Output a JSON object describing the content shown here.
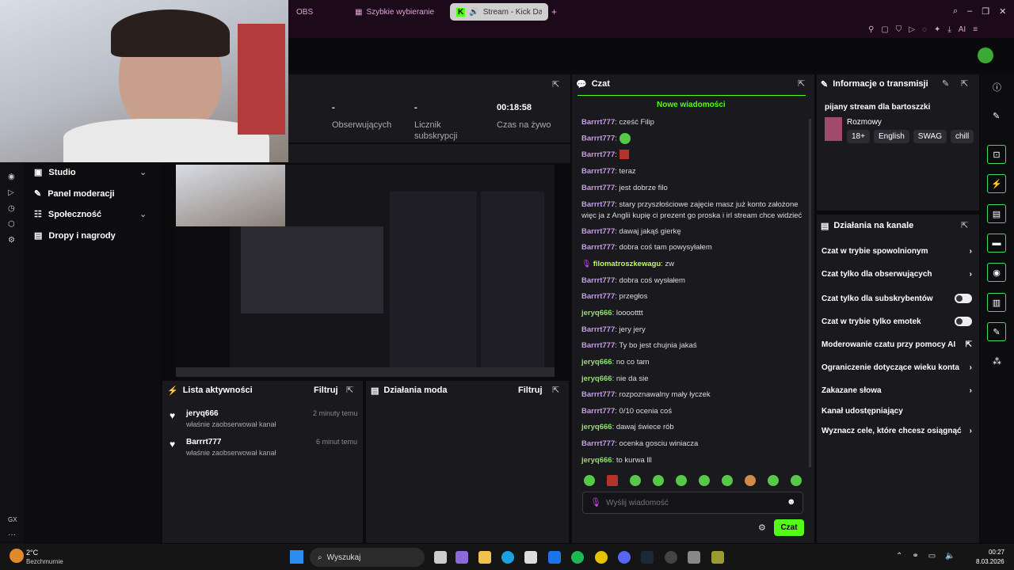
{
  "browser": {
    "tabs": [
      {
        "label": "OBS"
      },
      {
        "label": "Szybkie wybieranie"
      },
      {
        "label": "Stream - Kick Dashbo"
      }
    ],
    "new_tab_icon": "plus-icon",
    "ai_label": "AI"
  },
  "stats": [
    {
      "value": "-",
      "label": "Obserwujących"
    },
    {
      "value": "-",
      "label": "Licznik subskrypcji"
    },
    {
      "value": "00:18:58",
      "label": "Czas na żywo"
    }
  ],
  "sidebar": {
    "items": [
      {
        "label": "Studio",
        "icon": "studio-icon"
      },
      {
        "label": "Panel moderacji",
        "icon": "wrench-icon"
      },
      {
        "label": "Społeczność",
        "icon": "community-icon"
      },
      {
        "label": "Dropy i nagrody",
        "icon": "gift-icon"
      }
    ],
    "bottom_label": "GX"
  },
  "activity": {
    "title": "Lista aktywności",
    "filter": "Filtruj",
    "items": [
      {
        "user": "jeryq666",
        "sub": "właśnie zaobserwował kanał",
        "time": "2 minuty temu"
      },
      {
        "user": "Barrrt777",
        "sub": "właśnie zaobserwował kanał",
        "time": "6 minut temu"
      }
    ]
  },
  "moderation": {
    "title": "Działania moda",
    "filter": "Filtruj"
  },
  "chat": {
    "title": "Czat",
    "new_messages": "Nowe wiadomości",
    "messages": [
      {
        "user": "Barrrt777",
        "text": "cześć Filip"
      },
      {
        "user": "Barrrt777",
        "text": ""
      },
      {
        "user": "Barrrt777",
        "text": ""
      },
      {
        "user": "Barrrt777",
        "text": "teraz"
      },
      {
        "user": "Barrrt777",
        "text": "jest dobrze filo"
      },
      {
        "user": "Barrrt777",
        "text": "stary przyszłościowe zajęcie masz już konto założone więc ja z Anglii kupię ci prezent go proska i irl stream chce widzieć"
      },
      {
        "user": "Barrrt777",
        "text": "dawaj jakąś gierkę"
      },
      {
        "user": "Barrrt777",
        "text": "dobra coś tam powysyłałem"
      },
      {
        "user": "filomatroszkewagu",
        "text": "zw"
      },
      {
        "user": "Barrrt777",
        "text": "dobra coś wysłałem"
      },
      {
        "user": "Barrrt777",
        "text": "przegłos"
      },
      {
        "user": "jeryq666",
        "text": "looootttt"
      },
      {
        "user": "Barrrt777",
        "text": "jery jery"
      },
      {
        "user": "Barrrt777",
        "text": "Ty bo jest chujnia jakaś"
      },
      {
        "user": "jeryq666",
        "text": "no co tam"
      },
      {
        "user": "jeryq666",
        "text": "nie da sie"
      },
      {
        "user": "Barrrt777",
        "text": "rozpoznawalny mały łyczek"
      },
      {
        "user": "Barrrt777",
        "text": "0/10 ocenia coś"
      },
      {
        "user": "jeryq666",
        "text": "dawaj świece rób"
      },
      {
        "user": "Barrrt777",
        "text": "ocenka gosciu winiacza"
      },
      {
        "user": "jeryq666",
        "text": "to kurwa lll"
      }
    ],
    "input_placeholder": "Wyślij wiadomość",
    "send_label": "Czat"
  },
  "info": {
    "title": "Informacje o transmisji",
    "stream_title": "pijany stream dla bartoszzki",
    "category": "Rozmowy",
    "tags": [
      "18+",
      "English",
      "SWAG",
      "chill"
    ]
  },
  "actions": {
    "title": "Działania na kanale",
    "items": [
      {
        "label": "Czat w trybie spowolnionym",
        "control": "chevron"
      },
      {
        "label": "Czat tylko dla obserwujących",
        "control": "chevron"
      },
      {
        "label": "Czat tylko dla subskrybentów",
        "control": "toggle"
      },
      {
        "label": "Czat w trybie tylko emotek",
        "control": "toggle"
      },
      {
        "label": "Moderowanie czatu przy pomocy AI",
        "control": "external"
      },
      {
        "label": "Ograniczenie dotyczące wieku konta",
        "control": "chevron"
      },
      {
        "label": "Zakazane słowa",
        "control": "chevron"
      },
      {
        "label": "Kanał udostępniający",
        "control": "none"
      },
      {
        "label": "Wyznacz cele, które chcesz osiągnąć",
        "control": "chevron"
      }
    ]
  },
  "taskbar": {
    "weather": "2°C",
    "weather_desc": "Bezchmurnie",
    "search": "Wyszukaj",
    "time": "00:27",
    "date": "8.03.2026"
  },
  "colors": {
    "accent": "#53fc18",
    "brand_bg": "#1c0a1a",
    "panel": "#1a1a1e"
  }
}
